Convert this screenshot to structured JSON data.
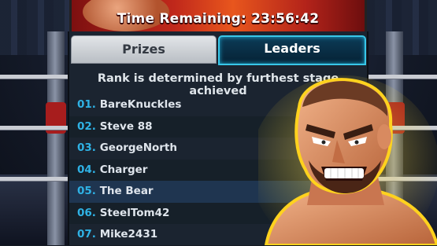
{
  "banner": {
    "time_remaining": "Time Remaining: 23:56:42"
  },
  "tabs": {
    "prizes": "Prizes",
    "leaders": "Leaders"
  },
  "leaderboard": {
    "rule": "Rank is determined by furthest stage achieved",
    "entries": [
      {
        "rank": "01.",
        "name": "BareKnuckles"
      },
      {
        "rank": "02.",
        "name": "Steve 88"
      },
      {
        "rank": "03.",
        "name": "GeorgeNorth"
      },
      {
        "rank": "04.",
        "name": "Charger"
      },
      {
        "rank": "05.",
        "name": "The Bear"
      },
      {
        "rank": "06.",
        "name": "SteelTom42"
      },
      {
        "rank": "07.",
        "name": "Mike2431"
      }
    ]
  },
  "colors": {
    "accent": "#2fb2e5",
    "active_tab_border": "#38c7e8",
    "glow": "#ffd21e"
  }
}
